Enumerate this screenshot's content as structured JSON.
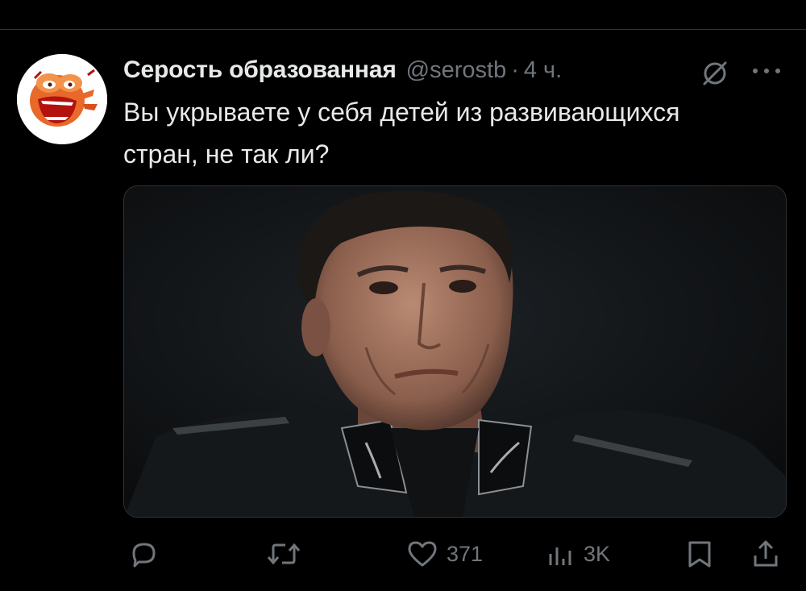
{
  "tweet": {
    "display_name": "Серость образованная",
    "handle": "@serostb",
    "separator": "·",
    "time": "4 ч.",
    "text": "Вы укрываете у себя детей из развивающихся стран, не так ли?",
    "media_icon": "movie-still-image"
  },
  "actions": {
    "reply_icon": "reply-icon",
    "retweet_icon": "retweet-icon",
    "like_icon": "heart-icon",
    "likes": "371",
    "views_icon": "views-chart-icon",
    "views": "3K",
    "bookmark_icon": "bookmark-icon",
    "share_icon": "share-icon"
  },
  "colors": {
    "background": "#000000",
    "text": "#e7e9ea",
    "secondary": "#71767b",
    "divider": "#2f3336"
  }
}
